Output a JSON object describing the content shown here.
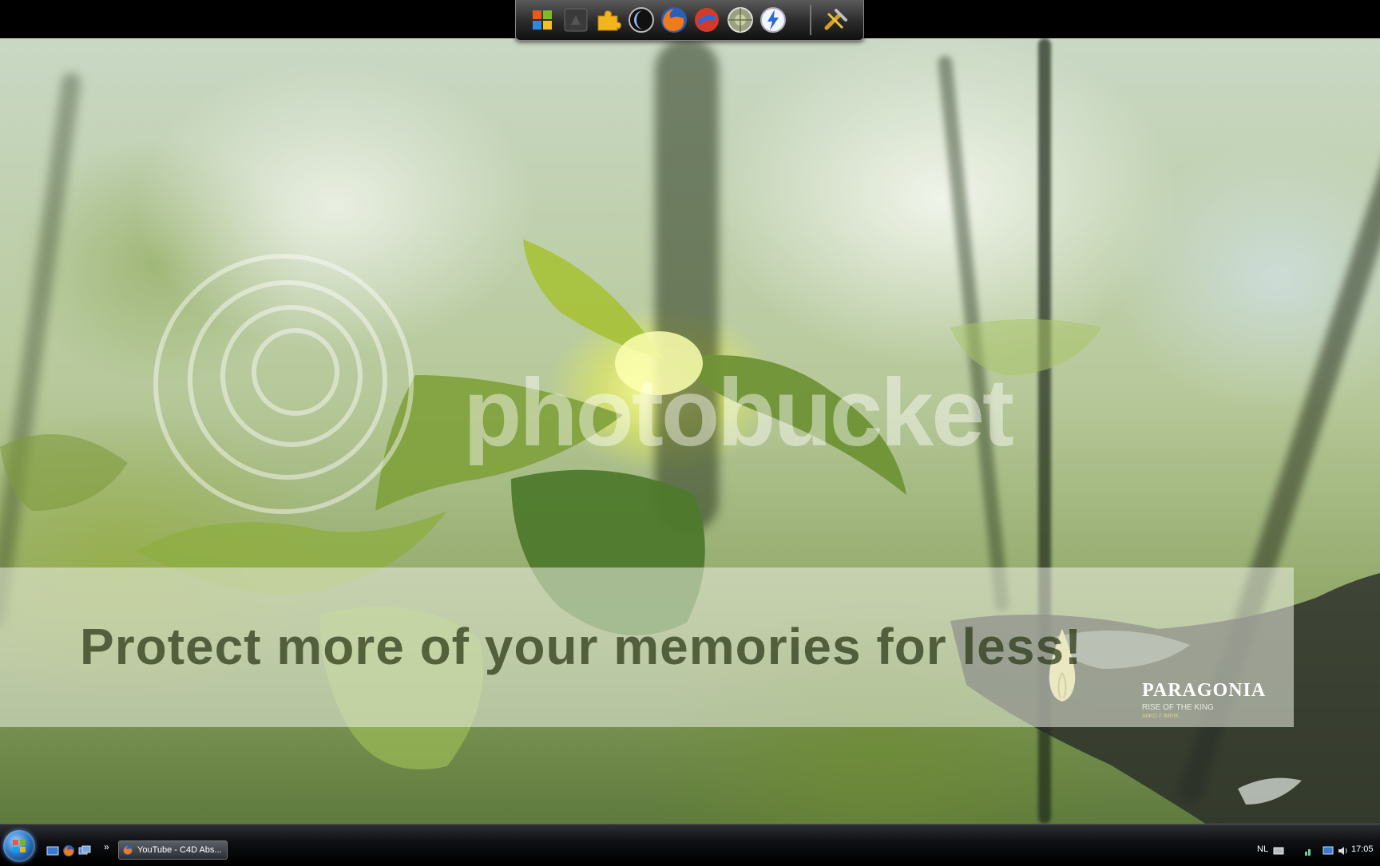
{
  "wallpaper": {
    "watermark_text": "photobucket",
    "promo_text": "Protect more of your memories for less!",
    "brand_title": "PARAGONIA",
    "brand_subtitle": "RISE OF THE KING",
    "brand_credit": "AIIKO // IMRIK"
  },
  "dock": {
    "icons": [
      "windows-colors-icon",
      "dark-window-icon",
      "puzzle-icon",
      "crescent-icon",
      "firefox-icon",
      "software-icon",
      "globe-icon",
      "lightning-icon",
      "tools-icon"
    ]
  },
  "taskbar": {
    "quick_launch": [
      "show-desktop-icon",
      "firefox-icon",
      "switch-windows-icon"
    ],
    "overflow_glyph": "»",
    "task_label": "YouTube - C4D Abs...",
    "language": "NL",
    "clock": "17:05"
  },
  "colors": {
    "accent": "#2a78c8",
    "taskbar": "#0e1014",
    "dock": "#2a2a2a"
  }
}
